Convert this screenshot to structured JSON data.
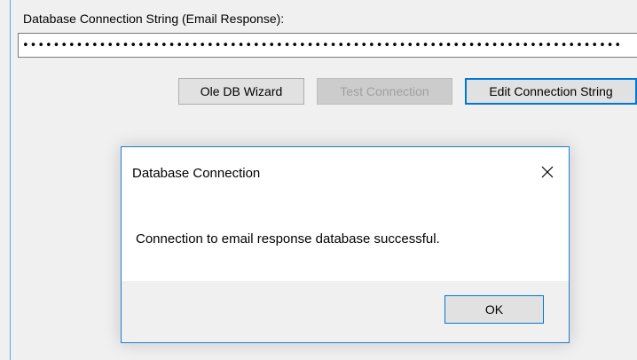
{
  "form": {
    "field_label": "Database Connection String (Email Response):",
    "connection_string_masked": "••••••••••••••••••••••••••••••••••••••••••••••••••••••••••••••••••••••••••••••",
    "buttons": {
      "ole_db_wizard": "Ole DB Wizard",
      "test_connection": "Test Connection",
      "edit_connection_string": "Edit Connection String"
    }
  },
  "dialog": {
    "title": "Database Connection",
    "message": "Connection to email response database successful.",
    "ok_label": "OK",
    "close_icon": "close-icon"
  },
  "colors": {
    "window_bg": "#f0f0f0",
    "accent": "#0078d7",
    "disabled_text": "#a0a0a0"
  }
}
